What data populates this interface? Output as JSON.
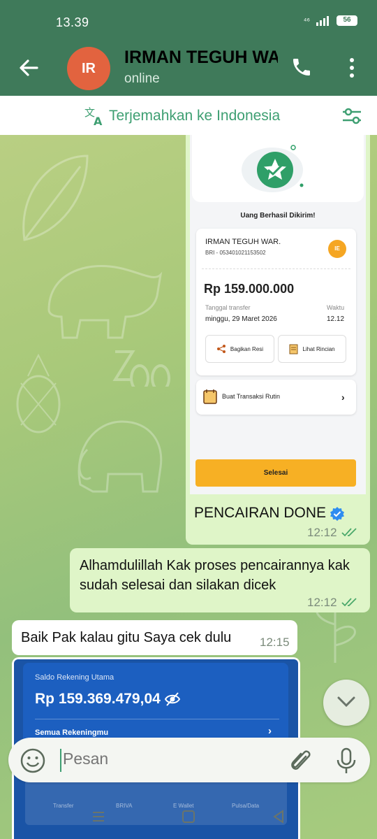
{
  "status_bar": {
    "time": "13.39",
    "signal": "⁴⁶",
    "battery": "56"
  },
  "header": {
    "avatar_initials": "IR",
    "contact_name": "IRMAN TEGUH WAR.",
    "contact_status": "online",
    "icons": [
      "back-arrow-icon",
      "phone-icon",
      "more-vert-icon"
    ]
  },
  "translate_bar": {
    "label": "Terjemahkan ke Indonesia"
  },
  "messages": {
    "receipt": {
      "title": "Uang Berhasil Dikirim!",
      "recipient_name": "IRMAN TEGUH WAR.",
      "recipient_account": "BRI - 053401021153502",
      "recipient_initials": "IE",
      "amount": "Rp 159.000.000",
      "date_label": "Tanggal transfer",
      "date_value": "minggu, 29 Maret 2026",
      "time_label": "Waktu",
      "time_value": "12.12",
      "share_label": "Bagikan Resi",
      "detail_label": "Lihat Rincian",
      "routine_label": "Buat Transaksi Rutin",
      "done_label": "Selesai"
    },
    "caption": {
      "text": "PENCAIRAN DONE",
      "time": "12:12"
    },
    "out_text": {
      "text": "Alhamdulillah Kak proses pencairannya kak sudah selesai dan silakan dicek",
      "time": "12:12"
    },
    "in_text": {
      "text": "Baik Pak kalau gitu Saya cek dulu",
      "time": "12:15"
    },
    "bank_image": {
      "label": "Saldo Rekening Utama",
      "amount": "Rp 159.369.479,04",
      "accounts_label": "Semua Rekeningmu",
      "menu_items": [
        "Transfer",
        "BRIVA",
        "E Wallet",
        "Pulsa/Data"
      ]
    }
  },
  "composer": {
    "placeholder": "Pesan"
  },
  "colors": {
    "header": "#3f7a5a",
    "accent": "#3e9f72",
    "outgoing": "#dff5c8",
    "incoming": "#ffffff"
  }
}
